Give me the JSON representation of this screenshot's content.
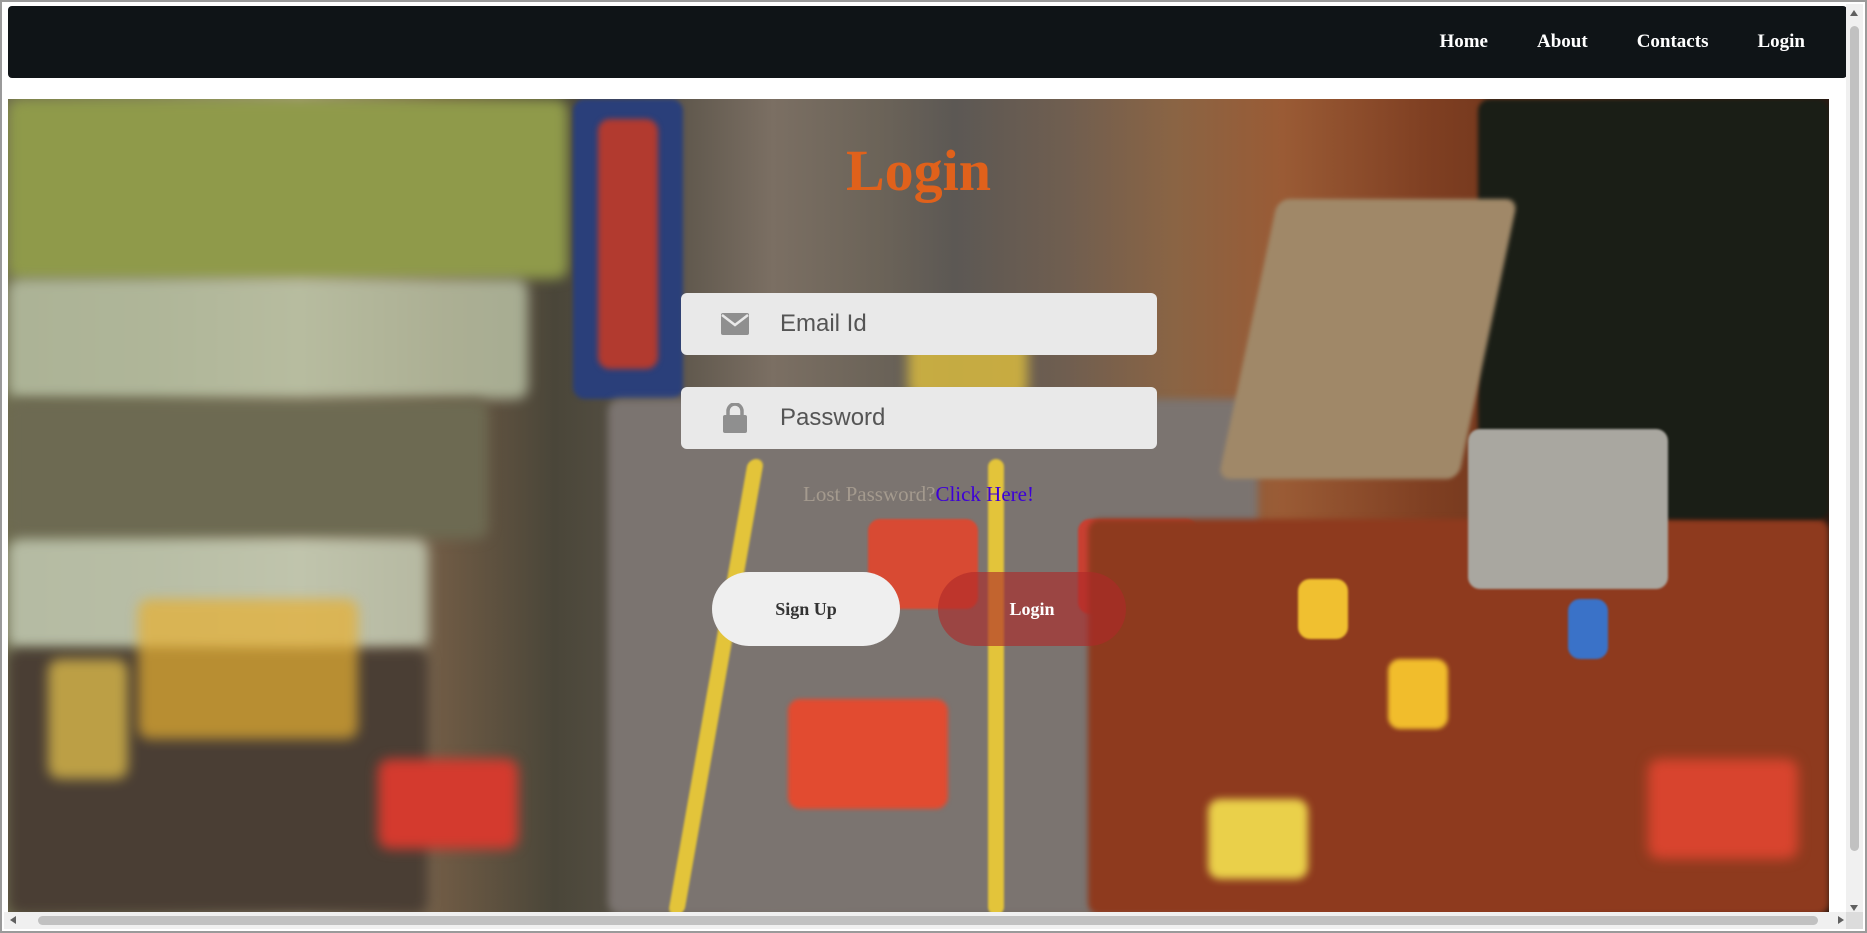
{
  "navbar": {
    "links": [
      "Home",
      "About",
      "Contacts",
      "Login"
    ]
  },
  "login_form": {
    "title": "Login",
    "email_placeholder": "Email Id",
    "email_icon": "envelope-icon",
    "password_placeholder": "Password",
    "password_icon": "lock-icon",
    "lost_password_text": "Lost Password?",
    "lost_password_link": "Click Here!",
    "signup_label": "Sign Up",
    "login_label": "Login"
  },
  "colors": {
    "navbar_bg": "#0f1417",
    "title": "#e0611b",
    "link": "#3d00d8",
    "login_button": "#af2828",
    "signup_button": "#efefef"
  },
  "background_image": "lego-city-street-scene"
}
